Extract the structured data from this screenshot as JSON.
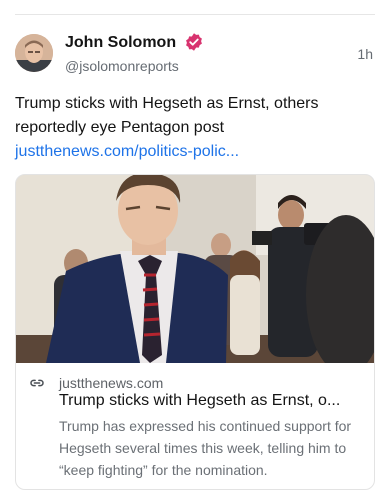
{
  "post": {
    "author_name": "John Solomon",
    "handle": "@jsolomonreports",
    "time": "1h",
    "verified_color": "#d8336f",
    "text": "Trump sticks with Hegseth as Ernst, others reportedly eye Pentagon post",
    "link_text": "justthenews.com/politics-polic..."
  },
  "card": {
    "domain": "justthenews.com",
    "title": "Trump sticks with Hegseth as Ernst, o...",
    "description": "Trump has expressed his continued support for Hegseth several times this week, telling him to “keep fighting” for the nomination.",
    "icon": "link-icon"
  },
  "colors": {
    "link": "#1e73e8",
    "muted": "#666c73"
  }
}
